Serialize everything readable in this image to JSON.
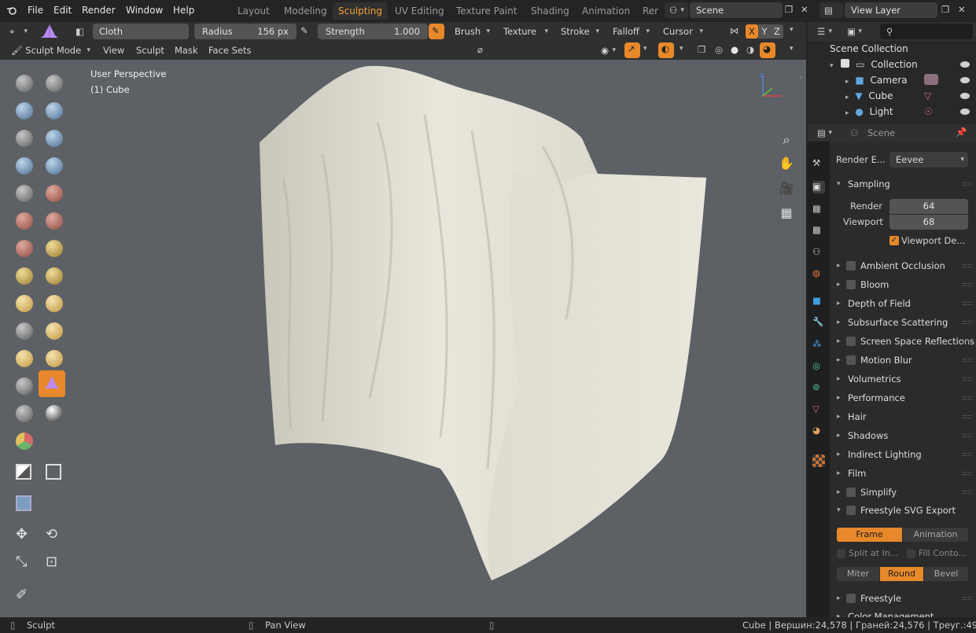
{
  "menu": [
    "File",
    "Edit",
    "Render",
    "Window",
    "Help"
  ],
  "workspaces": [
    "Layout",
    "Modeling",
    "Sculpting",
    "UV Editing",
    "Texture Paint",
    "Shading",
    "Animation",
    "Rer"
  ],
  "active_workspace": "Sculpting",
  "scene": {
    "name": "Scene"
  },
  "view_layer": {
    "name": "View Layer"
  },
  "tool_header": {
    "brush_name": "Cloth",
    "radius_label": "Radius",
    "radius_value": "156 px",
    "strength_label": "Strength",
    "strength_value": "1.000",
    "menus": [
      "Brush",
      "Texture",
      "Stroke",
      "Falloff",
      "Cursor"
    ],
    "axes": [
      "X",
      "Y",
      "Z"
    ]
  },
  "mode_header": {
    "mode": "Sculpt Mode",
    "menus": [
      "View",
      "Sculpt",
      "Mask",
      "Face Sets"
    ]
  },
  "viewport": {
    "perspective": "User Perspective",
    "object": "(1) Cube"
  },
  "outliner": {
    "root": "Scene Collection",
    "collection": "Collection",
    "items": [
      "Camera",
      "Cube",
      "Light"
    ]
  },
  "properties": {
    "context": "Scene",
    "render_engine_label": "Render E...",
    "render_engine": "Eevee",
    "sampling": {
      "title": "Sampling",
      "render_label": "Render",
      "render_value": "64",
      "viewport_label": "Viewport",
      "viewport_value": "68",
      "denoise_label": "Viewport De..."
    },
    "panels": [
      {
        "label": "Ambient Occlusion",
        "checkbox": true
      },
      {
        "label": "Bloom",
        "checkbox": true
      },
      {
        "label": "Depth of Field",
        "checkbox": false
      },
      {
        "label": "Subsurface Scattering",
        "checkbox": false
      },
      {
        "label": "Screen Space Reflections",
        "checkbox": true
      },
      {
        "label": "Motion Blur",
        "checkbox": true
      },
      {
        "label": "Volumetrics",
        "checkbox": false
      },
      {
        "label": "Performance",
        "checkbox": false
      },
      {
        "label": "Hair",
        "checkbox": false
      },
      {
        "label": "Shadows",
        "checkbox": false
      },
      {
        "label": "Indirect Lighting",
        "checkbox": false
      },
      {
        "label": "Film",
        "checkbox": false
      },
      {
        "label": "Simplify",
        "checkbox": true
      }
    ],
    "freestyle_svg": {
      "title": "Freestyle SVG Export",
      "frame": "Frame",
      "animation": "Animation",
      "split": "Split at In...",
      "fill": "Fill Conto...",
      "miter": "Miter",
      "round": "Round",
      "bevel": "Bevel"
    },
    "freestyle": "Freestyle",
    "color_management": "Color Management"
  },
  "status": {
    "left": "Sculpt",
    "middle": "Pan View",
    "right": "Cube | Вершин:24,578 | Граней:24,576 | Треуг.:49,"
  },
  "colors": {
    "accent": "#e7882a",
    "viewport_bg": "#5d6165",
    "cloth": "#e6e4d8"
  }
}
